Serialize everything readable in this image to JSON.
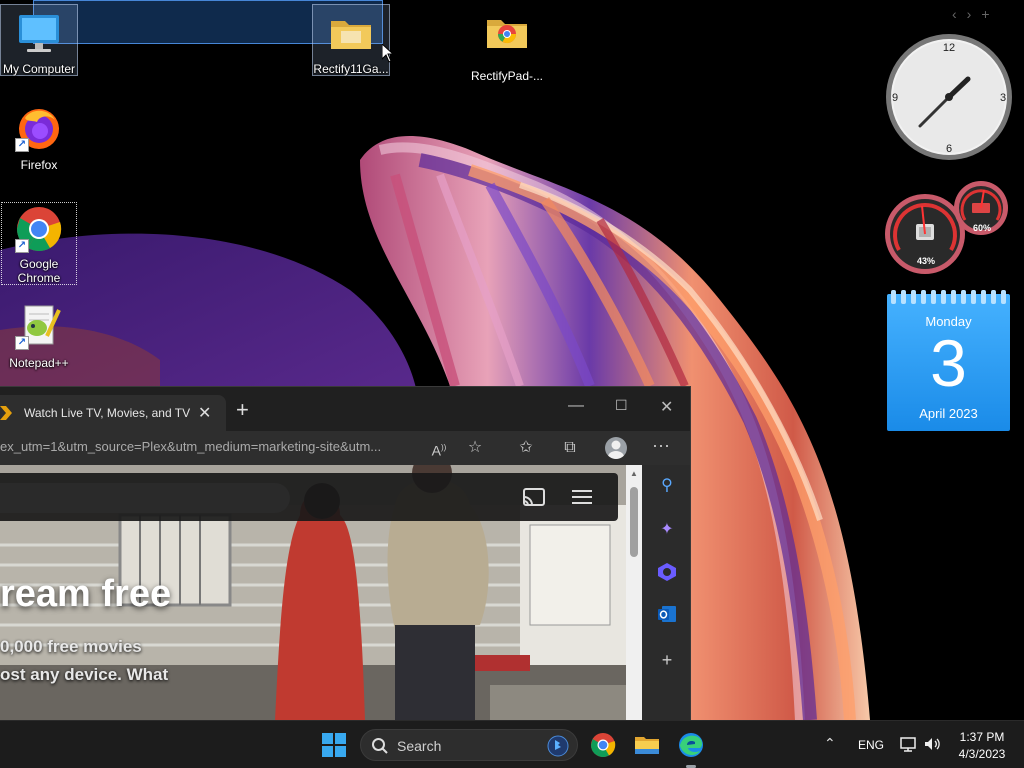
{
  "desktop": {
    "icons": [
      {
        "label": "My Computer"
      },
      {
        "label": "Rectify11Ga..."
      },
      {
        "label": "RectifyPad-..."
      },
      {
        "label": "Firefox"
      },
      {
        "label": "Google Chrome"
      },
      {
        "label": "Notepad++"
      }
    ]
  },
  "widgets": {
    "clock": {
      "n12": "12",
      "n3": "3",
      "n6": "6",
      "n9": "9"
    },
    "meters": {
      "cpu": "43%",
      "memory": "60%"
    },
    "calendar": {
      "day": "Monday",
      "date": "3",
      "month": "April 2023"
    }
  },
  "browser": {
    "tab_title": "Watch Live TV, Movies, and TV Sh",
    "address": "ex_utm=1&utm_source=Plex&utm_medium=marketing-site&utm...",
    "page": {
      "hero_title": "ream free",
      "hero_line1": "0,000 free movies",
      "hero_line2": "ost any device. What"
    }
  },
  "taskbar": {
    "search_label": "Search",
    "language": "ENG",
    "time": "1:37 PM",
    "date": "4/3/2023"
  },
  "colors": {
    "accent": "#1a8be8",
    "tray_bg": "#1c1c1c"
  }
}
